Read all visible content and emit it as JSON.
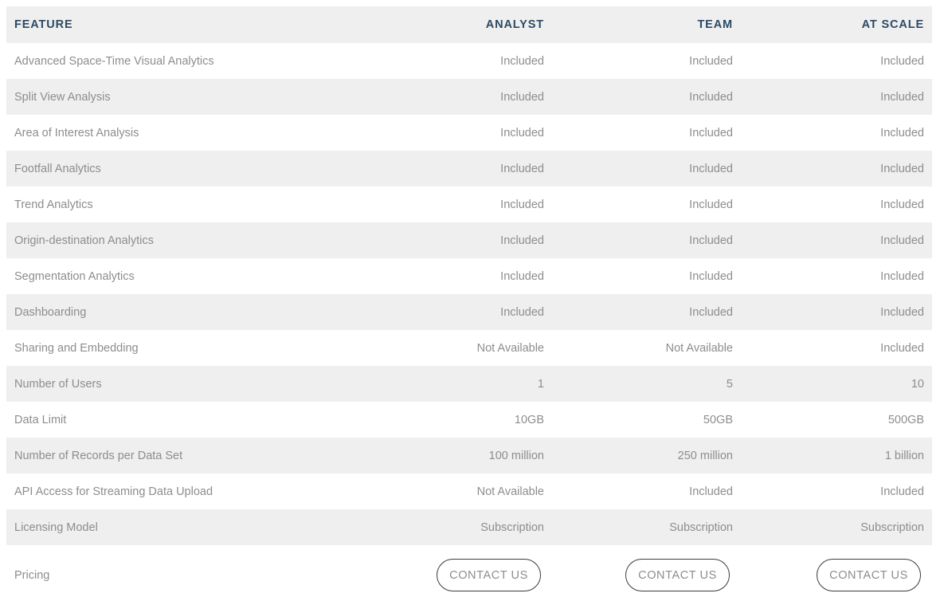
{
  "table": {
    "columns": [
      {
        "key": "feature",
        "label": "FEATURE",
        "align": "left"
      },
      {
        "key": "analyst",
        "label": "ANALYST",
        "align": "right"
      },
      {
        "key": "team",
        "label": "TEAM",
        "align": "right"
      },
      {
        "key": "at_scale",
        "label": "AT SCALE",
        "align": "right"
      }
    ],
    "header": {
      "feature": "FEATURE",
      "analyst": "ANALYST",
      "team": "TEAM",
      "at_scale": "AT SCALE"
    },
    "rows": [
      {
        "feature": "Advanced Space-Time Visual Analytics",
        "analyst": "Included",
        "team": "Included",
        "at_scale": "Included"
      },
      {
        "feature": "Split View Analysis",
        "analyst": "Included",
        "team": "Included",
        "at_scale": "Included"
      },
      {
        "feature": "Area of Interest Analysis",
        "analyst": "Included",
        "team": "Included",
        "at_scale": "Included"
      },
      {
        "feature": "Footfall Analytics",
        "analyst": "Included",
        "team": "Included",
        "at_scale": "Included"
      },
      {
        "feature": "Trend Analytics",
        "analyst": "Included",
        "team": "Included",
        "at_scale": "Included"
      },
      {
        "feature": "Origin-destination Analytics",
        "analyst": "Included",
        "team": "Included",
        "at_scale": "Included"
      },
      {
        "feature": "Segmentation Analytics",
        "analyst": "Included",
        "team": "Included",
        "at_scale": "Included"
      },
      {
        "feature": "Dashboarding",
        "analyst": "Included",
        "team": "Included",
        "at_scale": "Included"
      },
      {
        "feature": "Sharing and Embedding",
        "analyst": "Not Available",
        "team": "Not Available",
        "at_scale": "Included"
      },
      {
        "feature": "Number of Users",
        "analyst": "1",
        "team": "5",
        "at_scale": "10"
      },
      {
        "feature": "Data Limit",
        "analyst": "10GB",
        "team": "50GB",
        "at_scale": "500GB"
      },
      {
        "feature": "Number of Records per Data Set",
        "analyst": "100 million",
        "team": "250 million",
        "at_scale": "1 billion"
      },
      {
        "feature": "API Access for Streaming Data Upload",
        "analyst": "Not Available",
        "team": "Included",
        "at_scale": "Included"
      },
      {
        "feature": "Licensing Model",
        "analyst": "Subscription",
        "team": "Subscription",
        "at_scale": "Subscription"
      }
    ],
    "pricing_row": {
      "feature": "Pricing",
      "analyst_cta": "CONTACT US",
      "team_cta": "CONTACT US",
      "at_scale_cta": "CONTACT US"
    }
  },
  "colors": {
    "header_bg": "#efefef",
    "header_text": "#2c4a66",
    "row_alt_bg": "#efefef",
    "row_bg": "#ffffff",
    "body_text": "#8d8d8d",
    "button_border": "#3b3b3b",
    "button_text": "#8d8d8d"
  }
}
